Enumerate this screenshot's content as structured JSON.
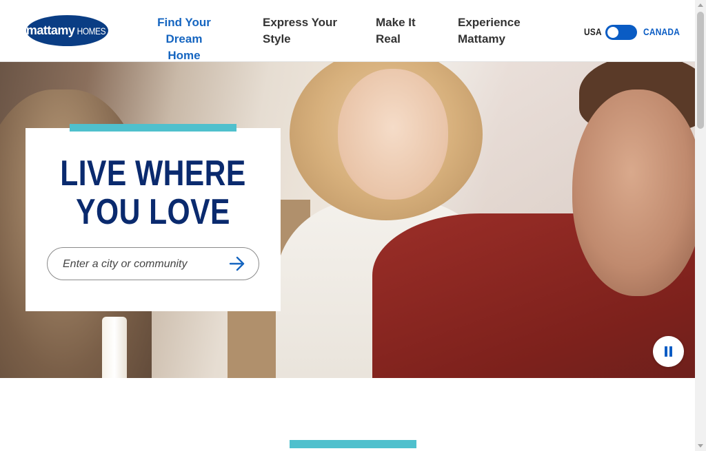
{
  "header": {
    "logo": {
      "bold": "mattamy",
      "light": "HOMES"
    },
    "nav": [
      {
        "line1": "Find Your Dream",
        "line2": "Home",
        "active": true
      },
      {
        "line1": "Express Your",
        "line2": "Style",
        "active": false
      },
      {
        "line1": "Make It",
        "line2": "Real",
        "active": false
      },
      {
        "line1": "Experience",
        "line2": "Mattamy",
        "active": false
      }
    ],
    "country_toggle": {
      "left_label": "USA",
      "right_label": "CANADA",
      "selected": "USA"
    }
  },
  "hero": {
    "headline_line1": "LIVE WHERE",
    "headline_line2": "YOU LOVE",
    "search": {
      "placeholder": "Enter a city or community",
      "value": ""
    },
    "video_control": "pause-icon"
  },
  "colors": {
    "brand_navy": "#0a2a6e",
    "link_blue": "#1565c0",
    "accent_teal": "#4fc0cd",
    "toggle_blue": "#0a5cc4"
  }
}
